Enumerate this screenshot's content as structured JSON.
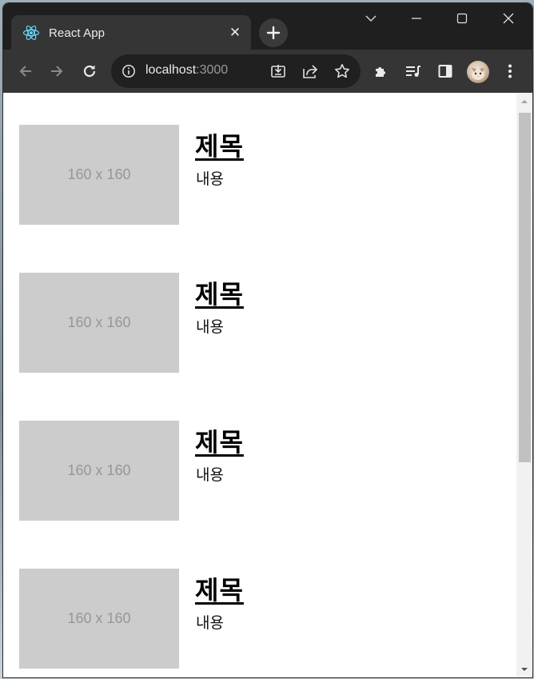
{
  "browser": {
    "tab_title": "React App",
    "tab_close": "✕",
    "url_host": "localhost",
    "url_port": ":3000"
  },
  "icons": {
    "favicon": "react-logo-icon",
    "new_tab": "plus-icon",
    "back": "arrow-left-icon",
    "forward": "arrow-right-icon",
    "reload": "reload-icon",
    "site_info": "info-icon",
    "install": "install-icon",
    "share": "share-icon",
    "bookmark": "star-icon",
    "extensions": "puzzle-icon",
    "media": "playlist-icon",
    "side_panel": "side-panel-icon",
    "menu": "kebab-menu-icon"
  },
  "colors": {
    "tab_strip": "#1f1f1f",
    "toolbar": "#353535",
    "placeholder_bg": "#cccccc",
    "placeholder_text": "#969696"
  },
  "cards": [
    {
      "image_text": "160 x 160",
      "title": "제목",
      "body": "내용"
    },
    {
      "image_text": "160 x 160",
      "title": "제목",
      "body": "내용"
    },
    {
      "image_text": "160 x 160",
      "title": "제목",
      "body": "내용"
    },
    {
      "image_text": "160 x 160",
      "title": "제목",
      "body": "내용"
    }
  ]
}
